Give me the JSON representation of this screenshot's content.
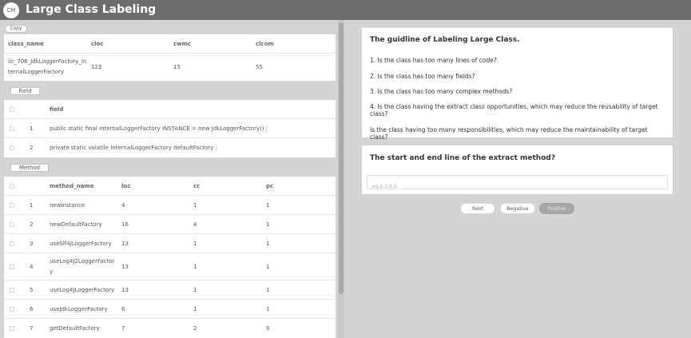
{
  "app": {
    "logo": "CM",
    "title": "Large Class Labeling"
  },
  "copy_label": "Copy",
  "class_table": {
    "headers": [
      "class_name",
      "cloc",
      "cwmc",
      "clcom"
    ],
    "row": {
      "class_name_line1": "ilc_706_JdkLoggerFactory_In",
      "class_name_line2": "ternalLoggerFactory",
      "cloc": "123",
      "cwmc": "15",
      "clcom": "55"
    }
  },
  "field_section": {
    "tag": "Field",
    "header": "field",
    "rows": [
      {
        "no": "1",
        "field": "public static final InternalLoggerFactory INSTANCE = new JdkLoggerFactory() ;"
      },
      {
        "no": "2",
        "field": "private static volatile InternalLoggerFactory defaultFactory ;"
      }
    ]
  },
  "method_section": {
    "tag": "Method",
    "headers": [
      "method_name",
      "loc",
      "cc",
      "pc"
    ],
    "rows": [
      {
        "no": "1",
        "name": "newInstance",
        "loc": "4",
        "cc": "1",
        "pc": "1"
      },
      {
        "no": "2",
        "name": "newDefaultFactory",
        "loc": "16",
        "cc": "4",
        "pc": "1"
      },
      {
        "no": "3",
        "name": "useSlf4JLoggerFactory",
        "loc": "13",
        "cc": "1",
        "pc": "1"
      },
      {
        "no": "4",
        "name_line1": "useLog4J2LoggerFactor",
        "name_line2": "y",
        "loc": "13",
        "cc": "1",
        "pc": "1"
      },
      {
        "no": "5",
        "name": "useLog4JLoggerFactory",
        "loc": "13",
        "cc": "1",
        "pc": "1"
      },
      {
        "no": "6",
        "name": "useJdkLoggerFactory",
        "loc": "6",
        "cc": "1",
        "pc": "1"
      },
      {
        "no": "7",
        "name": "getDefaultFactory",
        "loc": "7",
        "cc": "2",
        "pc": "0"
      }
    ]
  },
  "guide": {
    "title": "The guidline of Labeling Large Class.",
    "items": [
      "1. Is the class has too many lines of code?",
      "2. Is the class has too many fields?",
      "3. Is the class has too many complex methods?",
      "4. Is the class having the extract class opportunities, which may reduce the reusability of target class?",
      "Is the class having too many responsibilities, which may reduce the maintainability of target class?"
    ]
  },
  "extract": {
    "question": "The start and end line of the extract method?",
    "placeholder": "eg.1-2,4-5"
  },
  "buttons": {
    "next": "Next",
    "negative": "Negative",
    "positive": "Positive"
  },
  "colors": {
    "topbar": "#6d6d6d",
    "background": "#d4d4d4",
    "disabled_button": "#a7a7a7"
  }
}
